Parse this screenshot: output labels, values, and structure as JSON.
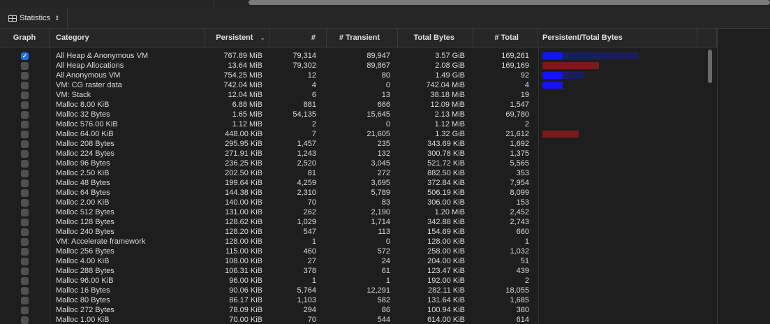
{
  "toolbar": {
    "view_label": "Statistics"
  },
  "columns": {
    "graph": "Graph",
    "category": "Category",
    "persistent": "Persistent",
    "count": "#",
    "transient": "# Transient",
    "total_bytes": "Total Bytes",
    "total": "# Total",
    "ratio": "Persistent/Total Bytes"
  },
  "colors": {
    "checkbox_on": "#1f6fe0",
    "bar_blue": "#1414ee",
    "bar_navy": "#1b1e5c",
    "bar_red": "#7a1a1a"
  },
  "rows": [
    {
      "checked": true,
      "category": "All Heap & Anonymous VM",
      "persistent": "767.89 MiB",
      "count": "79,314",
      "transient": "89,947",
      "total_bytes": "3.57 GiB",
      "total": "169,261",
      "ratio": {
        "color": "blue",
        "fraction": 0.21
      }
    },
    {
      "checked": false,
      "category": "All Heap Allocations",
      "persistent": "13.64 MiB",
      "count": "79,302",
      "transient": "89,867",
      "total_bytes": "2.08 GiB",
      "total": "169,169",
      "ratio": {
        "color": "red",
        "fraction": 0.006
      }
    },
    {
      "checked": false,
      "category": "All Anonymous VM",
      "persistent": "754.25 MiB",
      "count": "12",
      "transient": "80",
      "total_bytes": "1.49 GiB",
      "total": "92",
      "ratio": {
        "color": "blue",
        "fraction": 0.49
      }
    },
    {
      "checked": false,
      "category": "VM: CG raster data",
      "persistent": "742.04 MiB",
      "count": "4",
      "transient": "0",
      "total_bytes": "742.04 MiB",
      "total": "4",
      "ratio": {
        "color": "blue",
        "fraction": 1.0
      }
    },
    {
      "checked": false,
      "category": "VM: Stack",
      "persistent": "12.04 MiB",
      "count": "6",
      "transient": "13",
      "total_bytes": "38.18 MiB",
      "total": "19",
      "ratio": null
    },
    {
      "checked": false,
      "category": "Malloc 8.00 KiB",
      "persistent": "6.88 MiB",
      "count": "881",
      "transient": "666",
      "total_bytes": "12.09 MiB",
      "total": "1,547",
      "ratio": null
    },
    {
      "checked": false,
      "category": "Malloc 32 Bytes",
      "persistent": "1.65 MiB",
      "count": "54,135",
      "transient": "15,645",
      "total_bytes": "2.13 MiB",
      "total": "69,780",
      "ratio": null
    },
    {
      "checked": false,
      "category": "Malloc 576.00 KiB",
      "persistent": "1.12 MiB",
      "count": "2",
      "transient": "0",
      "total_bytes": "1.12 MiB",
      "total": "2",
      "ratio": null
    },
    {
      "checked": false,
      "category": "Malloc 64.00 KiB",
      "persistent": "448.00 KiB",
      "count": "7",
      "transient": "21,605",
      "total_bytes": "1.32 GiB",
      "total": "21,612",
      "ratio": {
        "color": "red",
        "fraction": 0.0003
      }
    },
    {
      "checked": false,
      "category": "Malloc 208 Bytes",
      "persistent": "295.95 KiB",
      "count": "1,457",
      "transient": "235",
      "total_bytes": "343.69 KiB",
      "total": "1,692",
      "ratio": null
    },
    {
      "checked": false,
      "category": "Malloc 224 Bytes",
      "persistent": "271.91 KiB",
      "count": "1,243",
      "transient": "132",
      "total_bytes": "300.78 KiB",
      "total": "1,375",
      "ratio": null
    },
    {
      "checked": false,
      "category": "Malloc 96 Bytes",
      "persistent": "236.25 KiB",
      "count": "2,520",
      "transient": "3,045",
      "total_bytes": "521.72 KiB",
      "total": "5,565",
      "ratio": null
    },
    {
      "checked": false,
      "category": "Malloc 2.50 KiB",
      "persistent": "202.50 KiB",
      "count": "81",
      "transient": "272",
      "total_bytes": "882.50 KiB",
      "total": "353",
      "ratio": null
    },
    {
      "checked": false,
      "category": "Malloc 48 Bytes",
      "persistent": "199.64 KiB",
      "count": "4,259",
      "transient": "3,695",
      "total_bytes": "372.84 KiB",
      "total": "7,954",
      "ratio": null
    },
    {
      "checked": false,
      "category": "Malloc 64 Bytes",
      "persistent": "144.38 KiB",
      "count": "2,310",
      "transient": "5,789",
      "total_bytes": "506.19 KiB",
      "total": "8,099",
      "ratio": null
    },
    {
      "checked": false,
      "category": "Malloc 2.00 KiB",
      "persistent": "140.00 KiB",
      "count": "70",
      "transient": "83",
      "total_bytes": "306.00 KiB",
      "total": "153",
      "ratio": null
    },
    {
      "checked": false,
      "category": "Malloc 512 Bytes",
      "persistent": "131.00 KiB",
      "count": "262",
      "transient": "2,190",
      "total_bytes": "1.20 MiB",
      "total": "2,452",
      "ratio": null
    },
    {
      "checked": false,
      "category": "Malloc 128 Bytes",
      "persistent": "128.62 KiB",
      "count": "1,029",
      "transient": "1,714",
      "total_bytes": "342.88 KiB",
      "total": "2,743",
      "ratio": null
    },
    {
      "checked": false,
      "category": "Malloc 240 Bytes",
      "persistent": "128.20 KiB",
      "count": "547",
      "transient": "113",
      "total_bytes": "154.69 KiB",
      "total": "660",
      "ratio": null
    },
    {
      "checked": false,
      "category": "VM: Accelerate framework",
      "persistent": "128.00 KiB",
      "count": "1",
      "transient": "0",
      "total_bytes": "128.00 KiB",
      "total": "1",
      "ratio": null
    },
    {
      "checked": false,
      "category": "Malloc 256 Bytes",
      "persistent": "115.00 KiB",
      "count": "460",
      "transient": "572",
      "total_bytes": "258.00 KiB",
      "total": "1,032",
      "ratio": null
    },
    {
      "checked": false,
      "category": "Malloc 4.00 KiB",
      "persistent": "108.00 KiB",
      "count": "27",
      "transient": "24",
      "total_bytes": "204.00 KiB",
      "total": "51",
      "ratio": null
    },
    {
      "checked": false,
      "category": "Malloc 288 Bytes",
      "persistent": "106.31 KiB",
      "count": "378",
      "transient": "61",
      "total_bytes": "123.47 KiB",
      "total": "439",
      "ratio": null
    },
    {
      "checked": false,
      "category": "Malloc 96.00 KiB",
      "persistent": "96.00 KiB",
      "count": "1",
      "transient": "1",
      "total_bytes": "192.00 KiB",
      "total": "2",
      "ratio": null
    },
    {
      "checked": false,
      "category": "Malloc 16 Bytes",
      "persistent": "90.06 KiB",
      "count": "5,764",
      "transient": "12,291",
      "total_bytes": "282.11 KiB",
      "total": "18,055",
      "ratio": null
    },
    {
      "checked": false,
      "category": "Malloc 80 Bytes",
      "persistent": "86.17 KiB",
      "count": "1,103",
      "transient": "582",
      "total_bytes": "131.64 KiB",
      "total": "1,685",
      "ratio": null
    },
    {
      "checked": false,
      "category": "Malloc 272 Bytes",
      "persistent": "78.09 KiB",
      "count": "294",
      "transient": "86",
      "total_bytes": "100.94 KiB",
      "total": "380",
      "ratio": null
    },
    {
      "checked": false,
      "category": "Malloc 1.00 KiB",
      "persistent": "70.00 KiB",
      "count": "70",
      "transient": "544",
      "total_bytes": "614.00 KiB",
      "total": "614",
      "ratio": null
    }
  ]
}
